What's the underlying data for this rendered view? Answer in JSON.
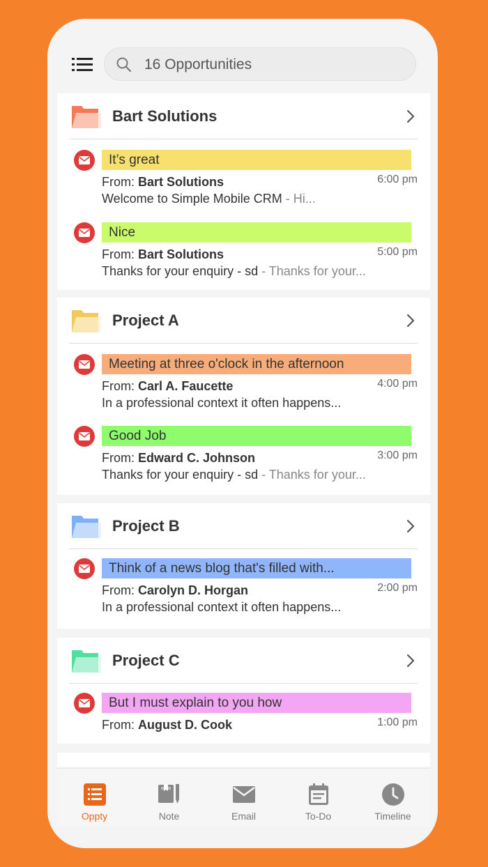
{
  "search": {
    "text": "16 Opportunities"
  },
  "cards": [
    {
      "title": "Bart Solutions",
      "folder_color": "#f47a55",
      "messages": [
        {
          "subject": "It’s great",
          "subject_color": "#f7e06e",
          "from_label": "From:",
          "from_name": "Bart Solutions",
          "time": "6:00 pm",
          "preview_main": "Welcome to Simple Mobile CRM",
          "preview_dim": " - Hi..."
        },
        {
          "subject": "Nice",
          "subject_color": "#cafb6a",
          "from_label": "From:",
          "from_name": "Bart Solutions",
          "time": "5:00 pm",
          "preview_main": "Thanks for your enquiry - sd",
          "preview_dim": " - Thanks for your..."
        }
      ]
    },
    {
      "title": "Project A",
      "folder_color": "#f2c95c",
      "messages": [
        {
          "subject": "Meeting at three o'clock in the afternoon",
          "subject_color": "#f8ac7a",
          "from_label": "From:",
          "from_name": "Carl A. Faucette",
          "time": "4:00 pm",
          "preview_main": "In a professional context it often happens...",
          "preview_dim": ""
        },
        {
          "subject": "Good Job",
          "subject_color": "#8ffc6e",
          "from_label": "From:",
          "from_name": "Edward C. Johnson",
          "time": "3:00 pm",
          "preview_main": "Thanks for your enquiry - sd",
          "preview_dim": " - Thanks for your..."
        }
      ]
    },
    {
      "title": "Project B",
      "folder_color": "#7fb0f5",
      "messages": [
        {
          "subject": "Think of a news blog that's filled with...",
          "subject_color": "#8fb6fb",
          "from_label": "From:",
          "from_name": "Carolyn D. Horgan",
          "time": "2:00 pm",
          "preview_main": "In a professional context it often happens...",
          "preview_dim": ""
        }
      ]
    },
    {
      "title": "Project C",
      "folder_color": "#4fe0a0",
      "messages": [
        {
          "subject": "But I must explain to you how",
          "subject_color": "#f3a6f3",
          "from_label": "From:",
          "from_name": "August D. Cook",
          "time": "1:00 pm",
          "preview_main": "",
          "preview_dim": ""
        }
      ]
    }
  ],
  "nav": [
    {
      "label": "Oppty",
      "icon": "list-icon",
      "active": true
    },
    {
      "label": "Note",
      "icon": "notebook-icon",
      "active": false
    },
    {
      "label": "Email",
      "icon": "envelope-icon",
      "active": false
    },
    {
      "label": "To-Do",
      "icon": "calendar-icon",
      "active": false
    },
    {
      "label": "Timeline",
      "icon": "clock-icon",
      "active": false
    }
  ],
  "colors": {
    "background": "#f5812a",
    "accent": "#e8671b",
    "mail_badge": "#dd3a3a"
  }
}
